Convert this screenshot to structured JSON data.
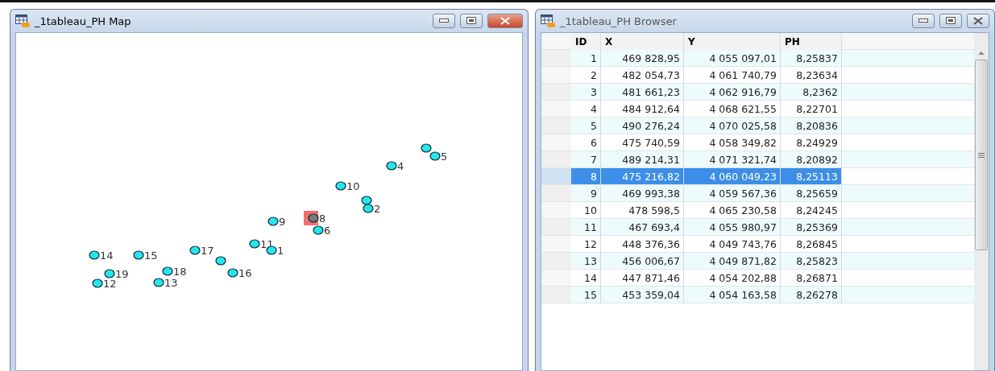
{
  "map_window": {
    "title": "_1tableau_PH Map",
    "points": [
      {
        "selected": false
      },
      {
        "label": "5",
        "selected": false
      },
      {
        "label": "4",
        "selected": false
      },
      {
        "label": "10",
        "selected": false
      },
      {
        "selected": false
      },
      {
        "label": "2",
        "selected": false
      },
      {
        "label": "8",
        "selected": true
      },
      {
        "label": "9",
        "selected": false
      },
      {
        "label": "6",
        "selected": false
      },
      {
        "label": "11",
        "selected": false
      },
      {
        "label": "17",
        "selected": false
      },
      {
        "label": "1",
        "selected": false
      },
      {
        "label": "14",
        "selected": false
      },
      {
        "label": "15",
        "selected": false
      },
      {
        "selected": false
      },
      {
        "label": "19",
        "selected": false
      },
      {
        "label": "18",
        "selected": false
      },
      {
        "label": "16",
        "selected": false
      },
      {
        "label": "12",
        "selected": false
      },
      {
        "label": "13",
        "selected": false
      }
    ]
  },
  "browser_window": {
    "title": "_1tableau_PH Browser",
    "columns": [
      "ID",
      "X",
      "Y",
      "PH"
    ],
    "rows": [
      {
        "cells": [
          "1",
          "469 828,95",
          "4 055 097,01",
          "8,25837"
        ],
        "selected": false
      },
      {
        "cells": [
          "2",
          "482 054,73",
          "4 061 740,79",
          "8,23634"
        ],
        "selected": false
      },
      {
        "cells": [
          "3",
          "481 661,23",
          "4 062 916,79",
          "8,2362"
        ],
        "selected": false
      },
      {
        "cells": [
          "4",
          "484 912,64",
          "4 068 621,55",
          "8,22701"
        ],
        "selected": false
      },
      {
        "cells": [
          "5",
          "490 276,24",
          "4 070 025,58",
          "8,20836"
        ],
        "selected": false
      },
      {
        "cells": [
          "6",
          "475 740,59",
          "4 058 349,82",
          "8,24929"
        ],
        "selected": false
      },
      {
        "cells": [
          "7",
          "489 214,31",
          "4 071 321,74",
          "8,20892"
        ],
        "selected": false
      },
      {
        "cells": [
          "8",
          "475 216,82",
          "4 060 049,23",
          "8,25113"
        ],
        "selected": true
      },
      {
        "cells": [
          "9",
          "469 993,38",
          "4 059 567,36",
          "8,25659"
        ],
        "selected": false
      },
      {
        "cells": [
          "10",
          "478 598,5",
          "4 065 230,58",
          "8,24245"
        ],
        "selected": false
      },
      {
        "cells": [
          "11",
          "467 693,4",
          "4 055 980,97",
          "8,25369"
        ],
        "selected": false
      },
      {
        "cells": [
          "12",
          "448 376,36",
          "4 049 743,76",
          "8,26845"
        ],
        "selected": false
      },
      {
        "cells": [
          "13",
          "456 006,67",
          "4 049 871,82",
          "8,25823"
        ],
        "selected": false
      },
      {
        "cells": [
          "14",
          "447 871,46",
          "4 054 202,88",
          "8,26871"
        ],
        "selected": false
      },
      {
        "cells": [
          "15",
          "453 359,04",
          "4 054 163,58",
          "8,26278"
        ],
        "selected": false
      }
    ]
  }
}
